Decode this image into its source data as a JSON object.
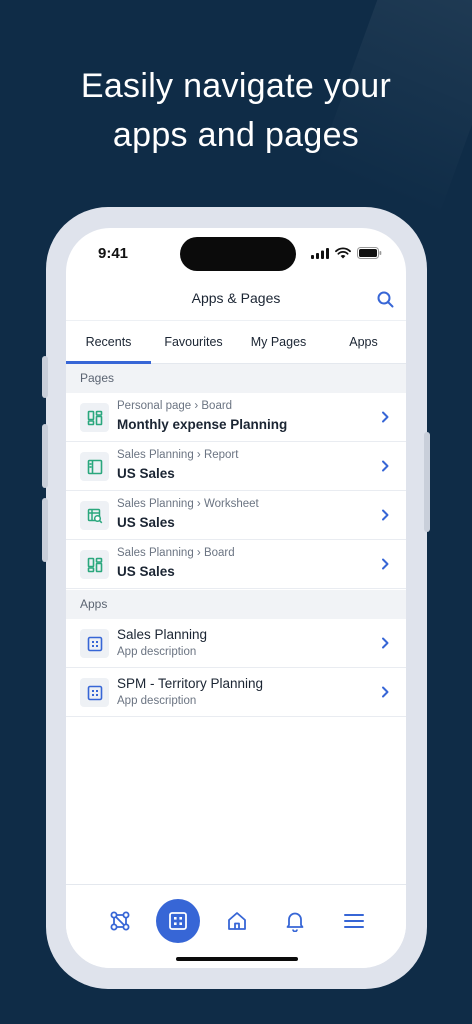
{
  "marketing": {
    "headline_line1": "Easily navigate your",
    "headline_line2": "apps and pages"
  },
  "status_bar": {
    "time": "9:41"
  },
  "header": {
    "title": "Apps & Pages",
    "search_icon": "search-icon"
  },
  "tabs": [
    {
      "label": "Recents",
      "active": true
    },
    {
      "label": "Favourites",
      "active": false
    },
    {
      "label": "My Pages",
      "active": false
    },
    {
      "label": "Apps",
      "active": false
    }
  ],
  "pages_section": {
    "title": "Pages",
    "items": [
      {
        "breadcrumb": "Personal page › Board",
        "title": "Monthly expense Planning",
        "icon": "board-icon"
      },
      {
        "breadcrumb": "Sales Planning › Report",
        "title": "US Sales",
        "icon": "report-icon"
      },
      {
        "breadcrumb": "Sales Planning › Worksheet",
        "title": "US Sales",
        "icon": "worksheet-icon"
      },
      {
        "breadcrumb": "Sales Planning › Board",
        "title": "US Sales",
        "icon": "board-icon"
      }
    ]
  },
  "apps_section": {
    "title": "Apps",
    "items": [
      {
        "title": "Sales Planning",
        "description": "App description",
        "icon": "app-icon"
      },
      {
        "title": "SPM - Territory Planning",
        "description": "App description",
        "icon": "app-icon"
      }
    ]
  },
  "bottom_nav": [
    {
      "icon": "network-icon",
      "active": false
    },
    {
      "icon": "apps-icon",
      "active": true
    },
    {
      "icon": "home-icon",
      "active": false
    },
    {
      "icon": "bell-icon",
      "active": false
    },
    {
      "icon": "menu-icon",
      "active": false
    }
  ],
  "colors": {
    "accent": "#3766d6",
    "background": "#0f2c47",
    "icon_green": "#2aa77d"
  }
}
